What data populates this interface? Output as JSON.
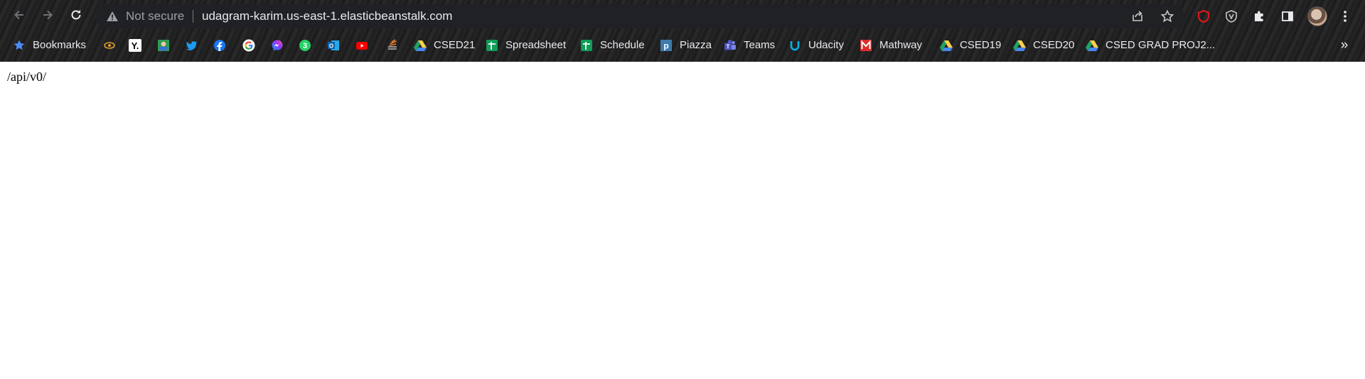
{
  "browser": {
    "security_label": "Not secure",
    "url": "udagram-karim.us-east-1.elasticbeanstalk.com",
    "icons": {
      "back": "arrow-left-icon",
      "forward": "arrow-right-icon",
      "reload": "reload-icon",
      "warning": "warning-triangle-icon",
      "share": "share-icon",
      "star": "star-icon",
      "extension_1": "red-shield-icon",
      "extension_2": "shield-icon",
      "extensions": "puzzle-icon",
      "side_panel": "side-panel-icon",
      "profile": "avatar",
      "menu": "kebab-menu-icon"
    }
  },
  "bookmarks": {
    "items": [
      {
        "label": "Bookmarks",
        "icon": "star-icon"
      },
      {
        "label": "",
        "icon": "eye-icon"
      },
      {
        "label": "",
        "icon": "y-icon"
      },
      {
        "label": "",
        "icon": "profile-card-icon"
      },
      {
        "label": "",
        "icon": "twitter-icon"
      },
      {
        "label": "",
        "icon": "facebook-icon"
      },
      {
        "label": "",
        "icon": "google-icon"
      },
      {
        "label": "",
        "icon": "messenger-icon"
      },
      {
        "label": "",
        "icon": "whatsapp-icon"
      },
      {
        "label": "",
        "icon": "outlook-icon"
      },
      {
        "label": "",
        "icon": "youtube-icon"
      },
      {
        "label": "",
        "icon": "stack-icon"
      },
      {
        "label": "CSED21",
        "icon": "google-drive-icon"
      },
      {
        "label": "Spreadsheet",
        "icon": "google-sheets-icon"
      },
      {
        "label": "Schedule",
        "icon": "google-sheets-icon"
      },
      {
        "label": "Piazza",
        "icon": "piazza-icon"
      },
      {
        "label": "Teams",
        "icon": "teams-icon"
      },
      {
        "label": "Udacity",
        "icon": "udacity-icon"
      },
      {
        "label": "Mathway",
        "icon": "mathway-icon"
      },
      {
        "label": "CSED19",
        "icon": "google-drive-icon"
      },
      {
        "label": "CSED20",
        "icon": "google-drive-icon"
      },
      {
        "label": "CSED GRAD PROJ2...",
        "icon": "google-drive-icon"
      }
    ],
    "overflow": "»"
  },
  "page": {
    "text": "/api/v0/"
  },
  "colors": {
    "chrome_dark": "#202124",
    "text_light": "#e8eaed",
    "text_muted": "#9aa0a6",
    "drive_green": "#1fa463",
    "drive_yellow": "#ffd04b",
    "drive_blue": "#4688f4",
    "sheets_green": "#0f9d58"
  }
}
